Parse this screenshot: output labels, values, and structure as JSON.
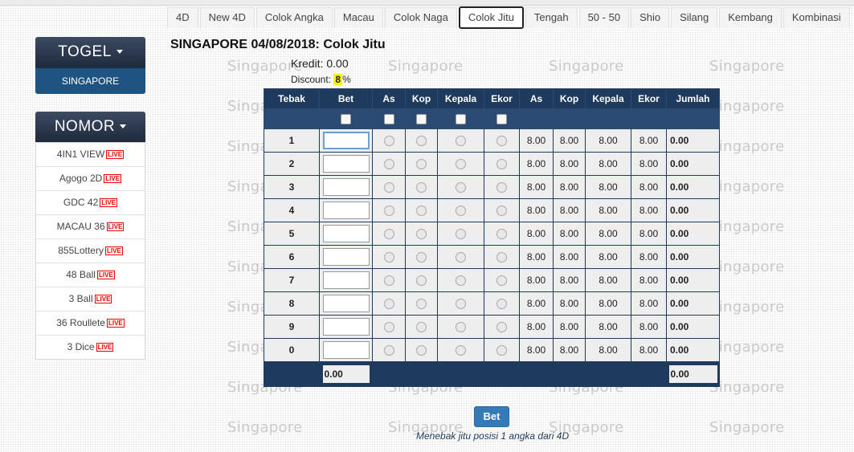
{
  "tabs": [
    "4D",
    "New 4D",
    "Colok Angka",
    "Macau",
    "Colok Naga",
    "Colok Jitu",
    "Tengah",
    "50 - 50",
    "Shio",
    "Silang",
    "Kembang",
    "Kombinasi"
  ],
  "active_tab": "Colok Jitu",
  "sidebar": {
    "togel": {
      "title": "TOGEL",
      "active_item": "SINGAPORE"
    },
    "nomor": {
      "title": "NOMOR",
      "items": [
        {
          "label": "4IN1 VIEW",
          "badge": "LIVE"
        },
        {
          "label": "Agogo 2D",
          "badge": "LIVE"
        },
        {
          "label": "GDC 42",
          "badge": "LIVE"
        },
        {
          "label": "MACAU 36",
          "badge": "LIVE"
        },
        {
          "label": "855Lottery",
          "badge": "LIVE"
        },
        {
          "label": "48 Ball",
          "badge": "LIVE"
        },
        {
          "label": "3 Ball",
          "badge": "LIVE"
        },
        {
          "label": "36 Roullete",
          "badge": "LIVE"
        },
        {
          "label": "3 Dice",
          "badge": "LIVE"
        }
      ]
    }
  },
  "header": {
    "title": "SINGAPORE 04/08/2018: Colok Jitu",
    "kredit": "Kredit: 0.00",
    "discount_label": "Discount:",
    "discount_value": "8",
    "discount_unit": "%"
  },
  "watermark": "Singapore",
  "table": {
    "headers": [
      "Tebak",
      "Bet",
      "As",
      "Kop",
      "Kepala",
      "Ekor",
      "As",
      "Kop",
      "Kepala",
      "Ekor",
      "Jumlah"
    ],
    "rows": [
      {
        "tebak": "1",
        "odds": [
          "8.00",
          "8.00",
          "8.00",
          "8.00"
        ],
        "jumlah": "0.00"
      },
      {
        "tebak": "2",
        "odds": [
          "8.00",
          "8.00",
          "8.00",
          "8.00"
        ],
        "jumlah": "0.00"
      },
      {
        "tebak": "3",
        "odds": [
          "8.00",
          "8.00",
          "8.00",
          "8.00"
        ],
        "jumlah": "0.00"
      },
      {
        "tebak": "4",
        "odds": [
          "8.00",
          "8.00",
          "8.00",
          "8.00"
        ],
        "jumlah": "0.00"
      },
      {
        "tebak": "5",
        "odds": [
          "8.00",
          "8.00",
          "8.00",
          "8.00"
        ],
        "jumlah": "0.00"
      },
      {
        "tebak": "6",
        "odds": [
          "8.00",
          "8.00",
          "8.00",
          "8.00"
        ],
        "jumlah": "0.00"
      },
      {
        "tebak": "7",
        "odds": [
          "8.00",
          "8.00",
          "8.00",
          "8.00"
        ],
        "jumlah": "0.00"
      },
      {
        "tebak": "8",
        "odds": [
          "8.00",
          "8.00",
          "8.00",
          "8.00"
        ],
        "jumlah": "0.00"
      },
      {
        "tebak": "9",
        "odds": [
          "8.00",
          "8.00",
          "8.00",
          "8.00"
        ],
        "jumlah": "0.00"
      },
      {
        "tebak": "0",
        "odds": [
          "8.00",
          "8.00",
          "8.00",
          "8.00"
        ],
        "jumlah": "0.00"
      }
    ],
    "total_bet": "0.00",
    "total_jumlah": "0.00"
  },
  "bet_button": "Bet",
  "description": "Menebak jitu posisi 1 angka dari 4D"
}
